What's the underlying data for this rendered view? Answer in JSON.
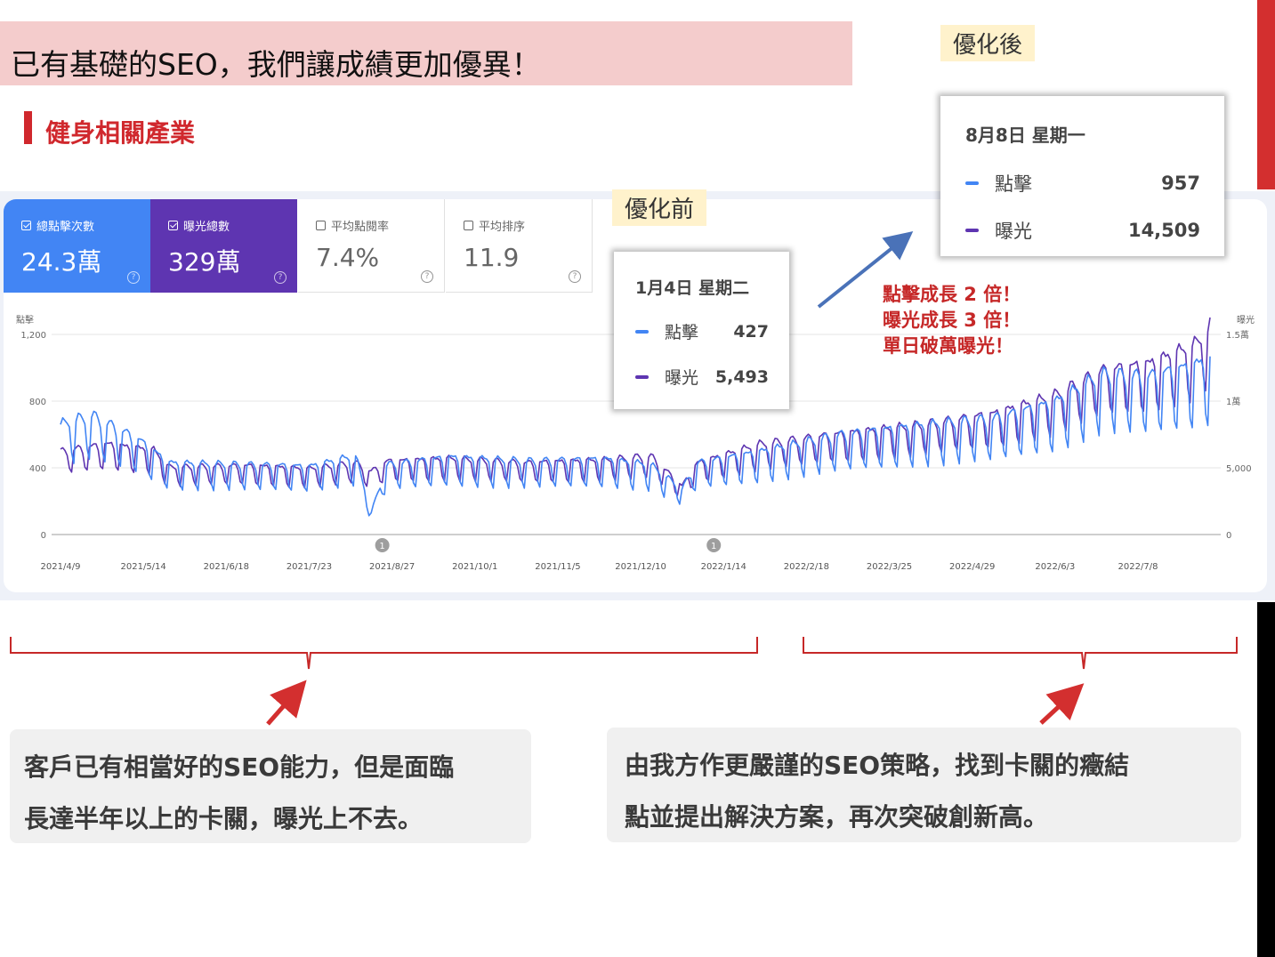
{
  "title": "已有基礎的SEO，我們讓成績更加優異！",
  "subtitle": "健身相關產業",
  "metrics": [
    {
      "label": "總點擊次數",
      "value": "24.3萬",
      "checked": true
    },
    {
      "label": "曝光總數",
      "value": "329萬",
      "checked": true
    },
    {
      "label": "平均點閱率",
      "value": "7.4%",
      "checked": false
    },
    {
      "label": "平均排序",
      "value": "11.9",
      "checked": false
    }
  ],
  "tags": {
    "before": "優化前",
    "after": "優化後"
  },
  "tooltip_before": {
    "date": "1月4日 星期二",
    "clicks_label": "點擊",
    "clicks": "427",
    "impr_label": "曝光",
    "impr": "5,493"
  },
  "tooltip_after": {
    "date": "8月8日 星期一",
    "clicks_label": "點擊",
    "clicks": "957",
    "impr_label": "曝光",
    "impr": "14,509"
  },
  "annotation": [
    "點擊成長 2 倍！",
    "曝光成長 3 倍！",
    "單日破萬曝光！"
  ],
  "bottom_left_lines": [
    "客戶已有相當好的SEO能力，但是面臨",
    "長達半年以上的卡關，曝光上不去。"
  ],
  "bottom_right_lines": [
    "由我方作更嚴謹的SEO策略，找到卡關的癥結",
    "點並提出解決方案，再次突破創新高。"
  ],
  "colors": {
    "clicks": "#4285f4",
    "impressions": "#5e35b1",
    "accent_red": "#d0282d",
    "title_bg": "#f4cccc",
    "tag_bg": "#fff2cc"
  },
  "chart_data": {
    "type": "line",
    "left_axis_label": "點擊",
    "right_axis_label": "曝光",
    "left_ticks": [
      "0",
      "400",
      "800",
      "1,200"
    ],
    "right_ticks": [
      "0",
      "5,000",
      "1萬",
      "1.5萬"
    ],
    "left_ylim": [
      0,
      1200
    ],
    "right_ylim": [
      0,
      15000
    ],
    "x_ticks": [
      "2021/4/9",
      "2021/5/14",
      "2021/6/18",
      "2021/7/23",
      "2021/8/27",
      "2021/10/1",
      "2021/11/5",
      "2021/12/10",
      "2022/1/14",
      "2022/2/18",
      "2022/3/25",
      "2022/4/29",
      "2022/6/3",
      "2022/7/8"
    ],
    "markers": [
      {
        "date": "2021/8/27",
        "label": "1"
      },
      {
        "date": "2022/1/14",
        "label": "1"
      }
    ],
    "series": [
      {
        "name": "點擊",
        "axis": "left",
        "keypoints": [
          {
            "week": 0,
            "value": 600
          },
          {
            "week": 2,
            "value": 650
          },
          {
            "week": 5,
            "value": 520
          },
          {
            "week": 7,
            "value": 390
          },
          {
            "week": 12,
            "value": 380
          },
          {
            "week": 16,
            "value": 370
          },
          {
            "week": 19,
            "value": 430
          },
          {
            "week": 20,
            "value": 120
          },
          {
            "week": 21,
            "value": 380
          },
          {
            "week": 25,
            "value": 420
          },
          {
            "week": 30,
            "value": 400
          },
          {
            "week": 35,
            "value": 410
          },
          {
            "week": 38,
            "value": 380
          },
          {
            "week": 40,
            "value": 250
          },
          {
            "week": 41,
            "value": 390
          },
          {
            "week": 45,
            "value": 450
          },
          {
            "week": 50,
            "value": 540
          },
          {
            "week": 55,
            "value": 590
          },
          {
            "week": 60,
            "value": 630
          },
          {
            "week": 64,
            "value": 720
          },
          {
            "week": 67,
            "value": 870
          },
          {
            "week": 70,
            "value": 860
          },
          {
            "week": 73,
            "value": 920
          },
          {
            "week": 74,
            "value": 957
          }
        ]
      },
      {
        "name": "曝光",
        "axis": "right",
        "keypoints": [
          {
            "week": 0,
            "value": 5800
          },
          {
            "week": 3,
            "value": 6300
          },
          {
            "week": 6,
            "value": 5900
          },
          {
            "week": 7,
            "value": 4700
          },
          {
            "week": 12,
            "value": 4800
          },
          {
            "week": 16,
            "value": 4600
          },
          {
            "week": 19,
            "value": 5000
          },
          {
            "week": 20,
            "value": 4400
          },
          {
            "week": 21,
            "value": 5100
          },
          {
            "week": 25,
            "value": 5300
          },
          {
            "week": 30,
            "value": 5000
          },
          {
            "week": 35,
            "value": 5200
          },
          {
            "week": 38,
            "value": 5493
          },
          {
            "week": 40,
            "value": 3400
          },
          {
            "week": 41,
            "value": 5000
          },
          {
            "week": 45,
            "value": 6300
          },
          {
            "week": 50,
            "value": 7000
          },
          {
            "week": 55,
            "value": 7600
          },
          {
            "week": 60,
            "value": 8400
          },
          {
            "week": 64,
            "value": 9700
          },
          {
            "week": 67,
            "value": 11400
          },
          {
            "week": 70,
            "value": 11900
          },
          {
            "week": 73,
            "value": 13200
          },
          {
            "week": 74,
            "value": 14509
          }
        ]
      }
    ]
  }
}
